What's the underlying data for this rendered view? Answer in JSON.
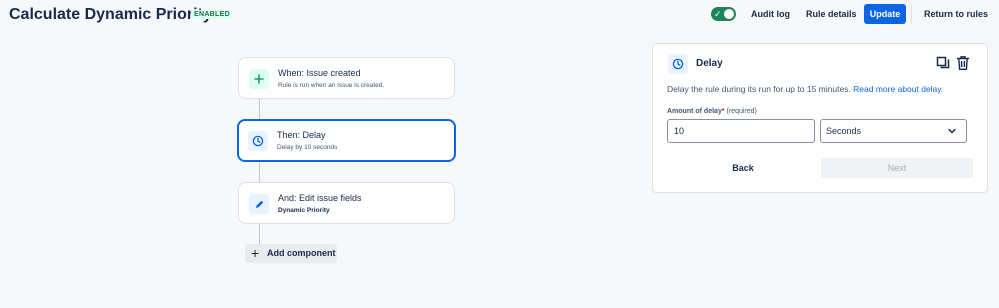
{
  "header": {
    "title": "Calculate Dynamic Priority",
    "status_badge": "ENABLED",
    "audit_log": "Audit log",
    "rule_details": "Rule details",
    "update": "Update",
    "return_to_rules": "Return to rules"
  },
  "components": [
    {
      "title": "When: Issue created",
      "subtitle": "Rule is run when an issue is created.",
      "icon": "plus-icon",
      "color": "#22a06b"
    },
    {
      "title": "Then: Delay",
      "subtitle": "Delay by 10 seconds",
      "icon": "clock-icon",
      "color": "#0c66e4"
    },
    {
      "title": "And: Edit issue fields",
      "subtitle": "Dynamic Priority",
      "icon": "pencil-icon",
      "color": "#0c66e4"
    }
  ],
  "add_component": "Add component",
  "panel": {
    "title": "Delay",
    "description": "Delay the rule during its run for up to 15 minutes.",
    "link": "Read more about delay",
    "link_suffix": ".",
    "field_label": "Amount of delay",
    "required_mark": "*",
    "required_text": "(required)",
    "amount_value": "10",
    "unit_value": "Seconds",
    "back": "Back",
    "next": "Next"
  },
  "colors": {
    "accent": "#0c66e4",
    "enabled_green": "#1f845a"
  }
}
